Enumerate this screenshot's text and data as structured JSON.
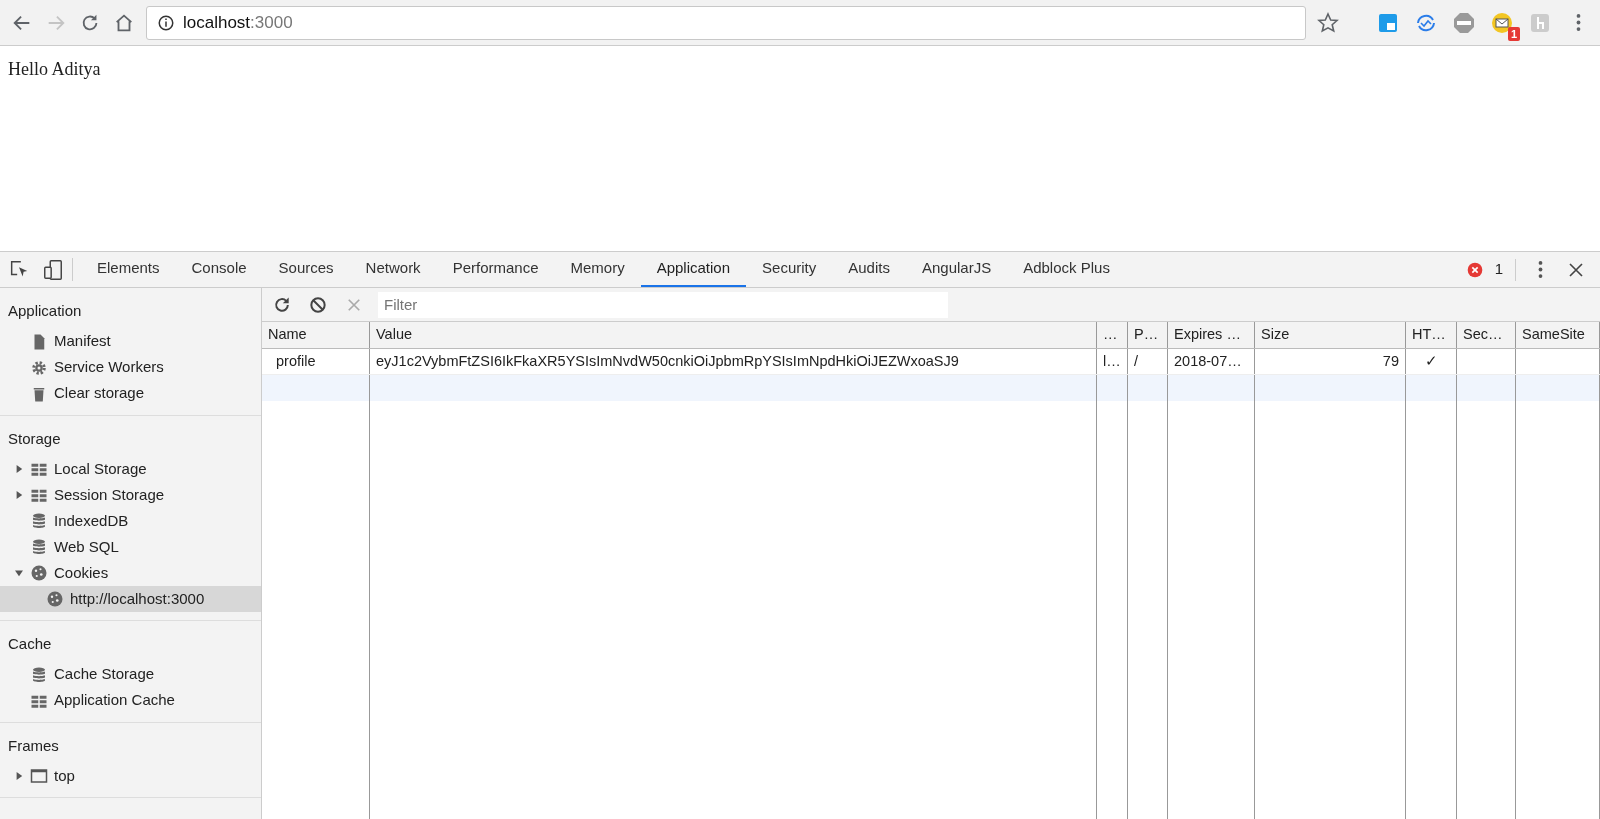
{
  "browser": {
    "address": {
      "host": "localhost",
      "port": ":3000"
    },
    "extension_badge": "1"
  },
  "page": {
    "text": "Hello Aditya"
  },
  "devtools": {
    "tabs": [
      {
        "label": "Elements",
        "selected": false
      },
      {
        "label": "Console",
        "selected": false
      },
      {
        "label": "Sources",
        "selected": false
      },
      {
        "label": "Network",
        "selected": false
      },
      {
        "label": "Performance",
        "selected": false
      },
      {
        "label": "Memory",
        "selected": false
      },
      {
        "label": "Application",
        "selected": true
      },
      {
        "label": "Security",
        "selected": false
      },
      {
        "label": "Audits",
        "selected": false
      },
      {
        "label": "AngularJS",
        "selected": false
      },
      {
        "label": "Adblock Plus",
        "selected": false
      }
    ],
    "error_count": "1",
    "sidebar": {
      "sections": [
        {
          "title": "Application",
          "items": [
            {
              "label": "Manifest",
              "kind": "file",
              "selected": false
            },
            {
              "label": "Service Workers",
              "kind": "gear",
              "selected": false
            },
            {
              "label": "Clear storage",
              "kind": "trash",
              "selected": false
            }
          ]
        },
        {
          "title": "Storage",
          "items": [
            {
              "label": "Local Storage",
              "kind": "grid",
              "expanded": false,
              "selected": false
            },
            {
              "label": "Session Storage",
              "kind": "grid",
              "expanded": false,
              "selected": false
            },
            {
              "label": "IndexedDB",
              "kind": "database",
              "selected": false
            },
            {
              "label": "Web SQL",
              "kind": "database",
              "selected": false
            },
            {
              "label": "Cookies",
              "kind": "cookie",
              "expanded": true,
              "selected": false,
              "children": [
                {
                  "label": "http://localhost:3000",
                  "kind": "cookie",
                  "selected": true
                }
              ]
            }
          ]
        },
        {
          "title": "Cache",
          "items": [
            {
              "label": "Cache Storage",
              "kind": "database",
              "selected": false
            },
            {
              "label": "Application Cache",
              "kind": "grid",
              "selected": false
            }
          ]
        },
        {
          "title": "Frames",
          "items": [
            {
              "label": "top",
              "kind": "frame",
              "expanded": false,
              "selected": false
            }
          ]
        }
      ]
    },
    "filter": {
      "placeholder": "Filter"
    },
    "table": {
      "columns": [
        {
          "label": "Name",
          "kind": "text"
        },
        {
          "label": "Value",
          "kind": "text"
        },
        {
          "label": "…",
          "kind": "text"
        },
        {
          "label": "P…",
          "kind": "text"
        },
        {
          "label": "Expires …",
          "kind": "text"
        },
        {
          "label": "Size",
          "kind": "number"
        },
        {
          "label": "HT…",
          "kind": "check"
        },
        {
          "label": "Sec…",
          "kind": "text"
        },
        {
          "label": "SameSite",
          "kind": "text"
        }
      ],
      "rows": [
        {
          "cells": [
            "profile",
            "eyJ1c2VybmFtZSI6IkFkaXR5YSIsImNvdW50cnkiOiJpbmRpYSIsImNpdHkiOiJEZWxoaSJ9",
            "l…",
            "/",
            "2018-07…",
            "79",
            "✓",
            "",
            ""
          ]
        }
      ]
    }
  }
}
